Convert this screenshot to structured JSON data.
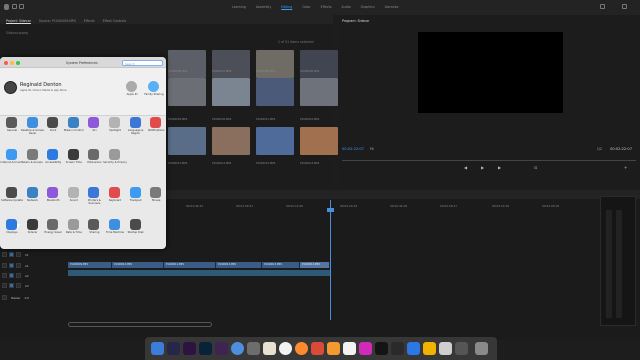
{
  "workspaces": [
    "Learning",
    "Assembly",
    "Editing",
    "Color",
    "Effects",
    "Audio",
    "Graphics",
    "Libraries"
  ],
  "active_workspace": "Editing",
  "project_panel": {
    "tabs": [
      "Project: Sidecar",
      "Source: P1040009.MP4",
      "Effects",
      "Effect Controls"
    ],
    "search_placeholder": "Sidecar.prproj",
    "items_selected": "1 of 51 items selected",
    "clips": [
      {
        "name": "P1040008.MP4",
        "dur": "1:22"
      },
      {
        "name": "P1040007.MP4",
        "dur": "1:12:00"
      },
      {
        "name": "P1040006.MP4",
        "dur": "1:18"
      },
      {
        "name": "P1040005.MP4",
        "dur": "1:08:09"
      },
      {
        "name": "P1040003.MP4",
        "dur": "1:35"
      },
      {
        "name": "P1040004.MP4",
        "dur": "1:04"
      },
      {
        "name": "P1040011.MP4",
        "dur": "1:09"
      },
      {
        "name": "P1040010.MP4",
        "dur": "1:09"
      },
      {
        "name": "P1040013.MP4",
        "dur": "1:29"
      },
      {
        "name": "P1040012.MP4",
        "dur": "1:45:12"
      },
      {
        "name": "P1040015.MP4",
        "dur": "1:13"
      },
      {
        "name": "P1040014.MP4",
        "dur": "1:23"
      }
    ]
  },
  "program_monitor": {
    "title": "Program: Sidecar",
    "timecode_left": "00:02:22:07",
    "fit": "Fit",
    "fraction": "1/2",
    "timecode_right": "00:02:22:07"
  },
  "timeline": {
    "ruler": [
      "00:01:44:22",
      "00:01:59:21",
      "00:02:14:20",
      "00:02:29:19",
      "00:02:44:18",
      "00:02:59:17",
      "00:03:14:16",
      "00:03:29:16"
    ],
    "tracks": [
      {
        "label": "V1"
      },
      {
        "label": "A1"
      },
      {
        "label": "A2"
      },
      {
        "label": "A3"
      }
    ],
    "master_label": "Master",
    "master_value": "0.0",
    "clip_labels": [
      "P1040009.MP4",
      "P1040010.MP4",
      "P1040011.MP4",
      "P1040012.MP4",
      "P1040013.MP4",
      "P1040014.MP4"
    ]
  },
  "system_preferences": {
    "title": "System Preferences",
    "search": "Search",
    "user_name": "Reginald Denton",
    "user_sub": "Apple ID, iCloud, Media & App Store",
    "apple_id": "Apple ID",
    "family_sharing": "Family Sharing",
    "rows": [
      [
        "General",
        "Desktop & Screen Saver",
        "Dock",
        "Mission Control",
        "Siri",
        "Spotlight",
        "Language & Region",
        "Notifications"
      ],
      [
        "Internet Accounts",
        "Users & Groups",
        "Accessibility",
        "Screen Time",
        "Extensions",
        "Security & Privacy"
      ],
      [
        "Software Update",
        "Network",
        "Bluetooth",
        "Sound",
        "Printers & Scanners",
        "Keyboard",
        "Trackpad",
        "Mouse"
      ],
      [
        "Displays",
        "Sidecar",
        "Energy Saver",
        "Date & Time",
        "Sharing",
        "Time Machine",
        "Startup Disk"
      ]
    ]
  }
}
